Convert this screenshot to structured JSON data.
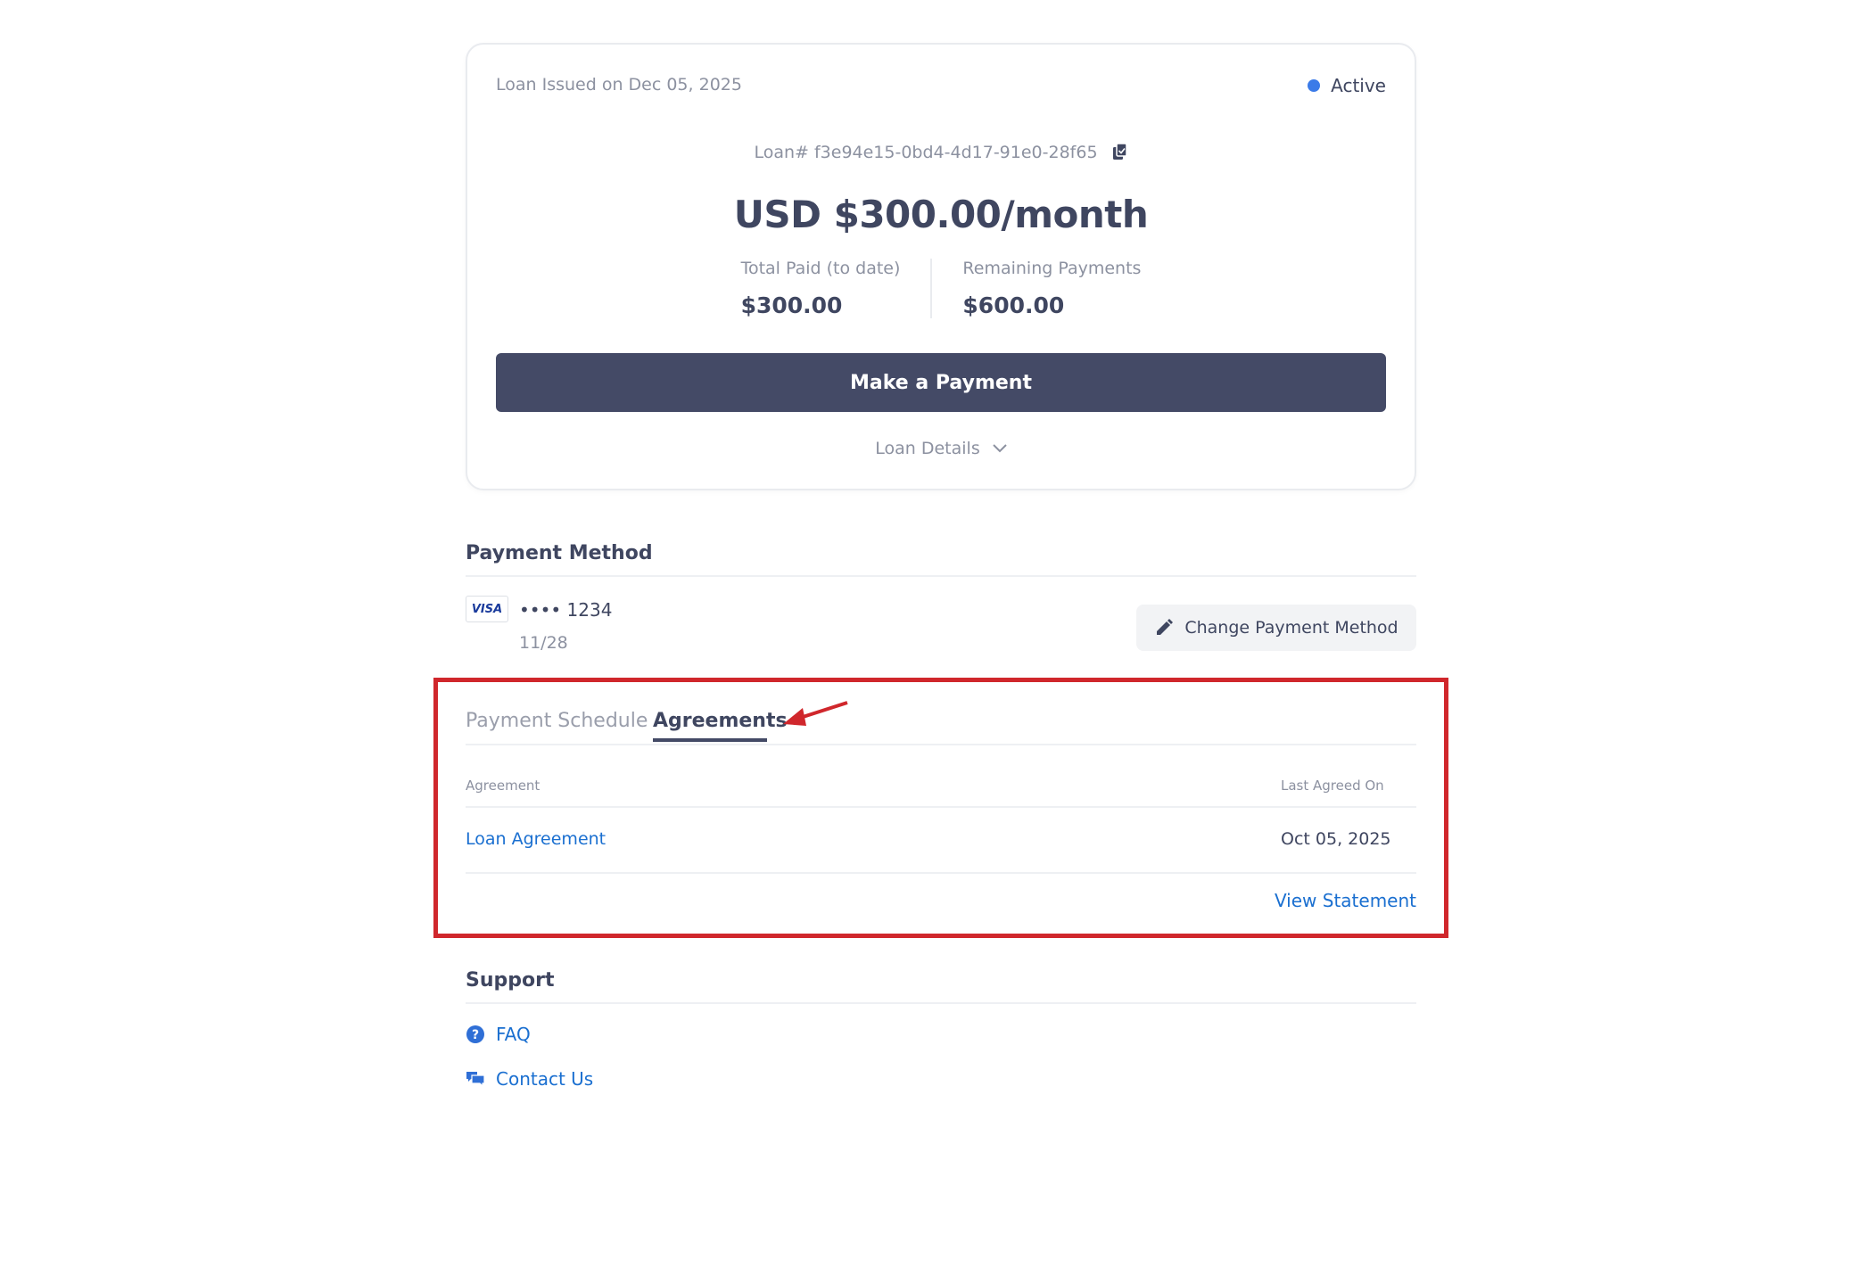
{
  "loan": {
    "issued_text": "Loan Issued on Dec 05, 2025",
    "status": "Active",
    "loan_number": "Loan# f3e94e15-0bd4-4d17-91e0-28f65",
    "amount": "USD $300.00/month",
    "total_paid_label": "Total Paid (to date)",
    "total_paid_value": "$300.00",
    "remaining_label": "Remaining Payments",
    "remaining_value": "$600.00",
    "pay_button": "Make a Payment",
    "details_label": "Loan Details"
  },
  "payment_method": {
    "title": "Payment Method",
    "card_brand": "VISA",
    "card_number": "•••• 1234",
    "card_expiry": "11/28",
    "change_button": "Change Payment Method"
  },
  "tabs": {
    "schedule": "Payment Schedule",
    "agreements": "Agreements"
  },
  "agreements_table": {
    "columns": [
      "Agreement",
      "Last Agreed On"
    ],
    "rows": [
      {
        "agreement": "Loan Agreement",
        "date": "Oct 05, 2025"
      }
    ],
    "view_statement": "View Statement"
  },
  "support": {
    "title": "Support",
    "faq": "FAQ",
    "contact": "Contact Us"
  },
  "colors": {
    "accent": "#444a66",
    "link": "#1a6fd0",
    "status_dot": "#3b7be8",
    "highlight": "#d0272c"
  }
}
